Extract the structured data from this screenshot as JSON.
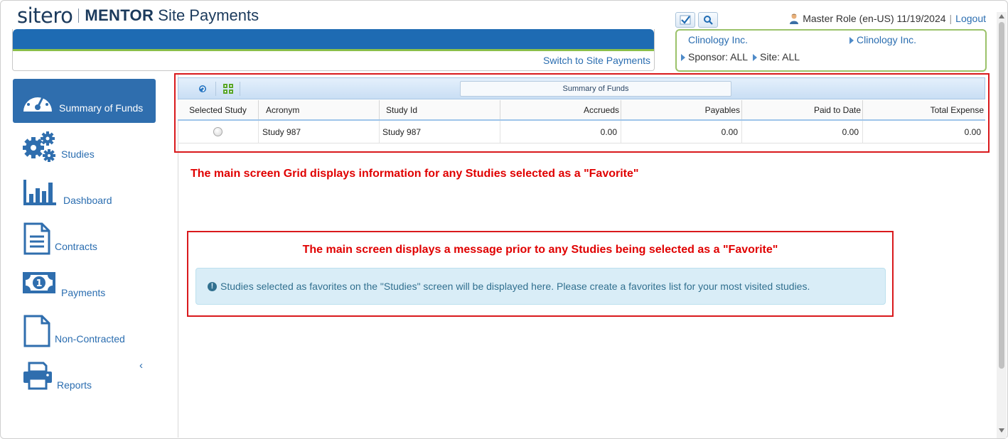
{
  "logo": {
    "mark": "sitero",
    "app_bold": "MENTOR",
    "app_rest": "Site Payments"
  },
  "header": {
    "switch_label": "Switch to Site Payments"
  },
  "user": {
    "text": "Master Role (en-US) 11/19/2024",
    "logout": "Logout"
  },
  "context": {
    "sponsor_org": "Clinology Inc.",
    "site_org": "Clinology Inc.",
    "sponsor_filter": "Sponsor: ALL",
    "site_filter": "Site: ALL"
  },
  "sidebar": {
    "items": [
      {
        "label": "Summary of Funds",
        "icon": "gauge-icon",
        "active": true
      },
      {
        "label": "Studies",
        "icon": "gears-icon"
      },
      {
        "label": "Dashboard",
        "icon": "bar-chart-icon"
      },
      {
        "label": "Contracts",
        "icon": "document-icon"
      },
      {
        "label": "Payments",
        "icon": "banknote-icon"
      },
      {
        "label": "Non-Contracted",
        "icon": "blank-document-icon"
      },
      {
        "label": "Reports",
        "icon": "printer-icon"
      }
    ],
    "collapse_label": "‹"
  },
  "grid": {
    "title": "Summary of Funds",
    "columns": [
      "Selected Study",
      "Acronym",
      "Study Id",
      "Accrueds",
      "Payables",
      "Paid to Date",
      "Total Expense"
    ],
    "rows": [
      {
        "acronym": "Study 987",
        "study_id": "Study 987",
        "accrueds": "0.00",
        "payables": "0.00",
        "paid_to_date": "0.00",
        "total_expense": "0.00"
      }
    ]
  },
  "annotations": {
    "grid_note": "The main screen Grid displays information for any Studies selected as a \"Favorite\"",
    "message_note": "The main screen displays a message prior to any Studies being selected as a \"Favorite\""
  },
  "info": {
    "message": "Studies selected as favorites on the \"Studies\" screen will be displayed here. Please create a favorites list for your most visited studies."
  },
  "colors": {
    "brand_blue": "#1e6bb3",
    "accent_green": "#8bbf4a",
    "annotation_red": "#e00000",
    "link_blue": "#2a6db0"
  }
}
